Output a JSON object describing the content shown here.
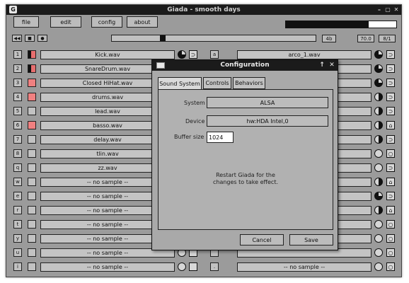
{
  "window": {
    "title": "Giada - smooth days",
    "app_icon": "G",
    "minimize_glyph": "–",
    "maximize_glyph": "▢",
    "close_glyph": "✕"
  },
  "menu": {
    "file": "file",
    "edit": "edit",
    "config": "config",
    "about": "about"
  },
  "transport": {
    "rewind_glyph": "◀◀",
    "stop_glyph": "■",
    "record_glyph": "●",
    "beats": "4b",
    "bpm": "70.0",
    "meter": "8/1"
  },
  "progress": {
    "position": 0.25,
    "output_level": 0.75
  },
  "left_rows": [
    {
      "key": "1",
      "label": "Kick.wav",
      "active": "#e76e6e",
      "half": true,
      "knob": "pie-dark",
      "btn": "⊃"
    },
    {
      "key": "2",
      "label": "SnareDrum.wav",
      "active": "#e76e6e",
      "half": true,
      "knob": "",
      "btn": ""
    },
    {
      "key": "3",
      "label": "Closed HiHat.wav",
      "active": "#f08080",
      "half": false,
      "knob": "",
      "btn": ""
    },
    {
      "key": "4",
      "label": "drums.wav",
      "active": "#f08080",
      "half": false,
      "knob": "",
      "btn": ""
    },
    {
      "key": "5",
      "label": "lead.wav",
      "active": "",
      "half": false,
      "knob": "",
      "btn": ""
    },
    {
      "key": "6",
      "label": "basso.wav",
      "active": "#f08080",
      "half": false,
      "knob": "",
      "btn": ""
    },
    {
      "key": "7",
      "label": "delay.wav",
      "active": "",
      "half": false,
      "knob": "",
      "btn": ""
    },
    {
      "key": "8",
      "label": "tlin.wav",
      "active": "",
      "half": false,
      "knob": "",
      "btn": ""
    },
    {
      "key": "q",
      "label": "zz.wav",
      "active": "",
      "half": false,
      "knob": "",
      "btn": ""
    },
    {
      "key": "w",
      "label": "-- no sample --",
      "active": "",
      "half": false,
      "knob": "",
      "btn": ""
    },
    {
      "key": "e",
      "label": "-- no sample --",
      "active": "",
      "half": false,
      "knob": "",
      "btn": ""
    },
    {
      "key": "r",
      "label": "-- no sample --",
      "active": "",
      "half": false,
      "knob": "",
      "btn": ""
    },
    {
      "key": "t",
      "label": "-- no sample --",
      "active": "",
      "half": false,
      "knob": "",
      "btn": ""
    },
    {
      "key": "y",
      "label": "-- no sample --",
      "active": "",
      "half": false,
      "knob": "",
      "btn": ""
    },
    {
      "key": "u",
      "label": "-- no sample --",
      "active": "",
      "half": false,
      "knob": "",
      "btn": ""
    },
    {
      "key": "i",
      "label": "-- no sample --",
      "active": "",
      "half": false,
      "knob": "",
      "btn": ""
    }
  ],
  "right_rows": [
    {
      "key": "a",
      "label": "arco_1.wav",
      "knob": "pie-dark",
      "btn": "⊃"
    },
    {
      "key": "",
      "label": "",
      "knob": "pie-dark",
      "btn": "⊃"
    },
    {
      "key": "",
      "label": "",
      "knob": "pie-dark",
      "btn": "⊃"
    },
    {
      "key": "",
      "label": "",
      "knob": "half",
      "btn": "⊃"
    },
    {
      "key": "",
      "label": "",
      "knob": "half",
      "btn": "⊃"
    },
    {
      "key": "",
      "label": "",
      "knob": "half",
      "btn": "⌂"
    },
    {
      "key": "",
      "label": "",
      "knob": "half",
      "btn": "⊃"
    },
    {
      "key": "",
      "label": "",
      "knob": "empty",
      "btn": "○"
    },
    {
      "key": "",
      "label": "",
      "knob": "empty",
      "btn": "⊃"
    },
    {
      "key": "",
      "label": "",
      "knob": "half",
      "btn": "⌂"
    },
    {
      "key": "",
      "label": "",
      "knob": "pie-dark",
      "btn": "⊃"
    },
    {
      "key": "",
      "label": "",
      "knob": "half",
      "btn": "⌂"
    },
    {
      "key": "",
      "label": "",
      "knob": "empty",
      "btn": "○"
    },
    {
      "key": "",
      "label": "",
      "knob": "empty",
      "btn": "○"
    },
    {
      "key": "",
      "label": "",
      "knob": "empty",
      "btn": "○"
    },
    {
      "key": ".",
      "label": "-- no sample --",
      "knob": "empty",
      "btn": "○"
    }
  ],
  "config_dialog": {
    "title": "Configuration",
    "tabs": [
      "Sound System",
      "Controls",
      "Behaviors"
    ],
    "system_label": "System",
    "system_value": "ALSA",
    "device_label": "Device",
    "device_value": "hw:HDA Intel,0",
    "buffer_label": "Buffer size",
    "buffer_value": "1024",
    "restart_note_1": "Restart Giada for the",
    "restart_note_2": "changes to take effect.",
    "cancel": "Cancel",
    "save": "Save",
    "up_glyph": "↑",
    "close_glyph": "✕"
  }
}
